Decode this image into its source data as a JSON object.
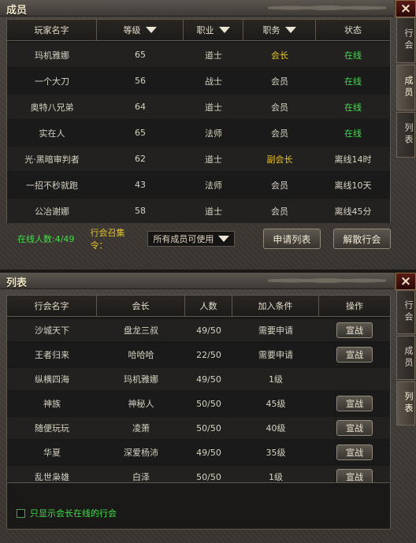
{
  "members_panel": {
    "title": "成员",
    "close_icon": "×",
    "side_tabs": [
      "行会",
      "成员",
      "列表"
    ],
    "columns": [
      "玩家名字",
      "等级",
      "职业",
      "职务",
      "状态"
    ],
    "rows": [
      {
        "name": "玛机雅娜",
        "level": "65",
        "class": "道士",
        "role": "会长",
        "status": "在线",
        "role_color": "gold",
        "status_color": "green"
      },
      {
        "name": "一个大刀",
        "level": "56",
        "class": "战士",
        "role": "会员",
        "status": "在线",
        "role_color": "",
        "status_color": "green"
      },
      {
        "name": "奥特八兄弟",
        "level": "64",
        "class": "道士",
        "role": "会员",
        "status": "在线",
        "role_color": "",
        "status_color": "green"
      },
      {
        "name": "实在人",
        "level": "65",
        "class": "法师",
        "role": "会员",
        "status": "在线",
        "role_color": "",
        "status_color": "green"
      },
      {
        "name": "光·黑暗审判者",
        "level": "62",
        "class": "道士",
        "role": "副会长",
        "status": "离线14时",
        "role_color": "gold",
        "status_color": ""
      },
      {
        "name": "一招不秒就跑",
        "level": "43",
        "class": "法师",
        "role": "会员",
        "status": "离线10天",
        "role_color": "",
        "status_color": ""
      },
      {
        "name": "公冶谢娜",
        "level": "58",
        "class": "道士",
        "role": "会员",
        "status": "离线45分",
        "role_color": "",
        "status_color": ""
      }
    ],
    "online_count": "在线人数:4/49",
    "summon_label": "行会召集令：",
    "summon_value": "所有成员可使用",
    "apply_button": "申请列表",
    "disband_button": "解散行会"
  },
  "list_panel": {
    "title": "列表",
    "close_icon": "×",
    "side_tabs": [
      "行会",
      "成员",
      "列表"
    ],
    "columns": [
      "行会名字",
      "会长",
      "人数",
      "加入条件",
      "操作"
    ],
    "rows": [
      {
        "guild": "沙城天下",
        "leader": "盘龙三叔",
        "count": "49/50",
        "condition": "需要申请",
        "action": "宣战"
      },
      {
        "guild": "王者归来",
        "leader": "哈哈哈",
        "count": "22/50",
        "condition": "需要申请",
        "action": "宣战"
      },
      {
        "guild": "纵横四海",
        "leader": "玛机雅娜",
        "count": "49/50",
        "condition": "1级",
        "action": ""
      },
      {
        "guild": "神族",
        "leader": "神秘人",
        "count": "50/50",
        "condition": "45级",
        "action": "宣战"
      },
      {
        "guild": "随便玩玩",
        "leader": "凌萧",
        "count": "50/50",
        "condition": "40级",
        "action": "宣战"
      },
      {
        "guild": "华夏",
        "leader": "深爱杨沛",
        "count": "49/50",
        "condition": "35级",
        "action": "宣战"
      },
      {
        "guild": "乱世枭雄",
        "leader": "白泽",
        "count": "50/50",
        "condition": "1级",
        "action": "宣战"
      }
    ],
    "checkbox_label": "只显示会长在线的行会"
  }
}
